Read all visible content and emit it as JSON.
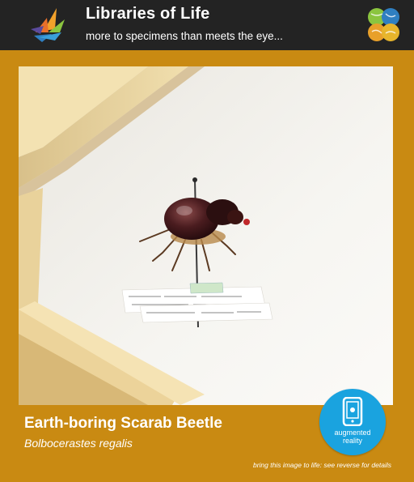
{
  "header": {
    "title": "Libraries of Life",
    "subtitle": "more to specimens than meets the eye...",
    "logo_icon": "libraries-of-life-logo-icon",
    "partner_icon": "four-leaf-circles-icon"
  },
  "specimen": {
    "common_name": "Earth-boring Scarab Beetle",
    "scientific_name": "Bolbocerastes regalis"
  },
  "badge": {
    "label_line1": "augmented",
    "label_line2": "reality",
    "icon": "smartphone-icon",
    "color": "#1aa3df"
  },
  "footer": {
    "note": "bring this image to life: see reverse for details"
  },
  "colors": {
    "frame": "#c98a12",
    "header_bg": "#232323"
  }
}
